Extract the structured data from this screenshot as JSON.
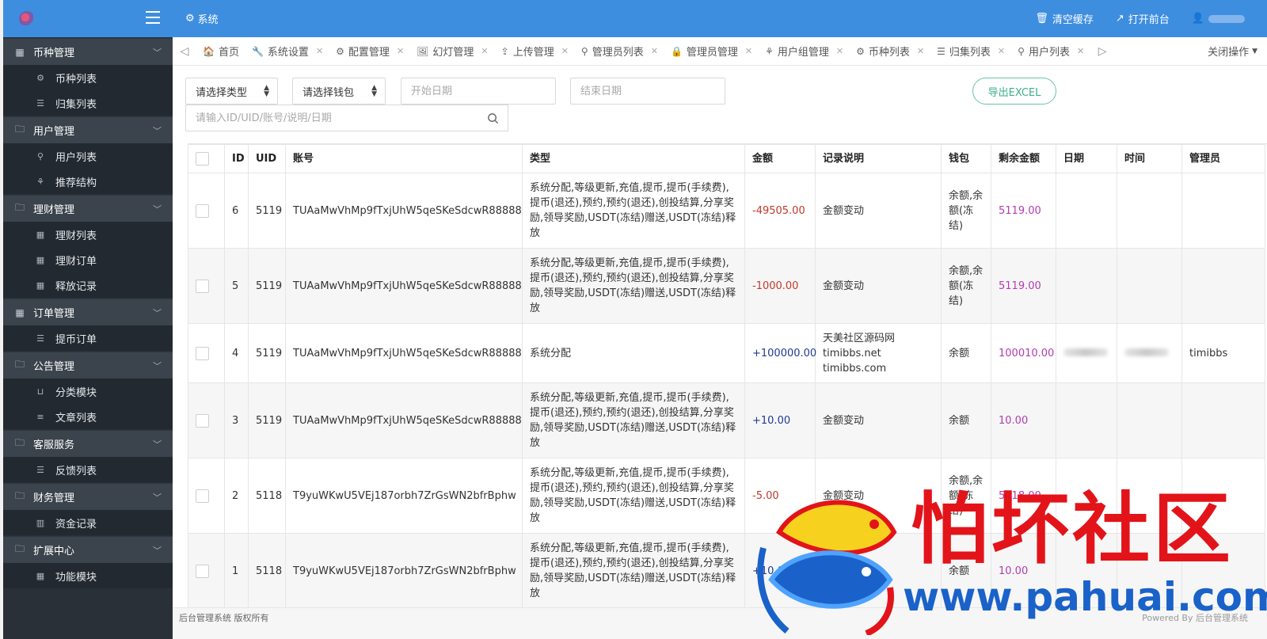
{
  "header": {
    "section": "系统",
    "clear_cache": "清空缓存",
    "open_frontend": "打开前台"
  },
  "sidebar": {
    "groups": [
      {
        "label": "币种管理",
        "items": [
          {
            "label": "币种列表",
            "icon": "cogs-icon"
          },
          {
            "label": "归集列表",
            "icon": "list-icon"
          }
        ]
      },
      {
        "label": "用户管理",
        "items": [
          {
            "label": "用户列表",
            "icon": "user-icon"
          },
          {
            "label": "推荐结构",
            "icon": "sitemap-icon"
          }
        ]
      },
      {
        "label": "理财管理",
        "items": [
          {
            "label": "理财列表",
            "icon": "grid-icon"
          },
          {
            "label": "理财订单",
            "icon": "grid-icon"
          },
          {
            "label": "释放记录",
            "icon": "grid-icon"
          }
        ]
      },
      {
        "label": "订单管理",
        "items": [
          {
            "label": "提币订单",
            "icon": "list-icon"
          }
        ]
      },
      {
        "label": "公告管理",
        "items": [
          {
            "label": "分类模块",
            "icon": "inbox-icon"
          },
          {
            "label": "文章列表",
            "icon": "align-icon"
          }
        ]
      },
      {
        "label": "客服服务",
        "items": [
          {
            "label": "反馈列表",
            "icon": "list-icon"
          }
        ]
      },
      {
        "label": "财务管理",
        "items": [
          {
            "label": "资金记录",
            "icon": "barcode-icon"
          }
        ]
      },
      {
        "label": "扩展中心",
        "items": [
          {
            "label": "功能模块",
            "icon": "grid-icon"
          }
        ]
      }
    ]
  },
  "tabs": {
    "items": [
      {
        "label": "首页",
        "closable": false
      },
      {
        "label": "系统设置",
        "closable": true
      },
      {
        "label": "配置管理",
        "closable": true
      },
      {
        "label": "幻灯管理",
        "closable": true
      },
      {
        "label": "上传管理",
        "closable": true
      },
      {
        "label": "管理员列表",
        "closable": true
      },
      {
        "label": "管理员管理",
        "closable": true
      },
      {
        "label": "用户组管理",
        "closable": true
      },
      {
        "label": "币种列表",
        "closable": true
      },
      {
        "label": "归集列表",
        "closable": true
      },
      {
        "label": "用户列表",
        "closable": true
      }
    ],
    "close_ops": "关闭操作"
  },
  "filters": {
    "type_select": "请选择类型",
    "wallet_select": "请选择钱包",
    "start_date_placeholder": "开始日期",
    "end_date_placeholder": "结束日期",
    "search_placeholder": "请输入ID/UID/账号/说明/日期",
    "export_label": "导出EXCEL"
  },
  "table": {
    "columns": [
      "ID",
      "UID",
      "账号",
      "类型",
      "金额",
      "记录说明",
      "钱包",
      "剩余金额",
      "日期",
      "时间",
      "管理员"
    ],
    "rows": [
      {
        "id": "6",
        "uid": "5119",
        "account": "TUAaMwVhMp9fTxjUhW5qeSKeSdcwR88888",
        "type": "系统分配,等级更新,充值,提币,提币(手续费),提币(退还),预约,预约(退还),创投结算,分享奖励,领导奖励,USDT(冻结)赠送,USDT(冻结)释放",
        "amount": "-49505.00",
        "sign": "neg",
        "note": "金额变动",
        "wallet": "余额,余额(冻结)",
        "remain": "5119.00",
        "admin": ""
      },
      {
        "id": "5",
        "uid": "5119",
        "account": "TUAaMwVhMp9fTxjUhW5qeSKeSdcwR88888",
        "type": "系统分配,等级更新,充值,提币,提币(手续费),提币(退还),预约,预约(退还),创投结算,分享奖励,领导奖励,USDT(冻结)赠送,USDT(冻结)释放",
        "amount": "-1000.00",
        "sign": "neg",
        "note": "金额变动",
        "wallet": "余额,余额(冻结)",
        "remain": "5119.00",
        "admin": ""
      },
      {
        "id": "4",
        "uid": "5119",
        "account": "TUAaMwVhMp9fTxjUhW5qeSKeSdcwR88888",
        "type": "系统分配",
        "amount": "+100000.00",
        "sign": "pos",
        "note": "天美社区源码网\ntimibbs.net\ntimibbs.com",
        "wallet": "余额",
        "remain": "100010.00",
        "admin": "timibbs"
      },
      {
        "id": "3",
        "uid": "5119",
        "account": "TUAaMwVhMp9fTxjUhW5qeSKeSdcwR88888",
        "type": "系统分配,等级更新,充值,提币,提币(手续费),提币(退还),预约,预约(退还),创投结算,分享奖励,领导奖励,USDT(冻结)赠送,USDT(冻结)释放",
        "amount": "+10.00",
        "sign": "pos",
        "note": "金额变动",
        "wallet": "余额",
        "remain": "10.00",
        "admin": ""
      },
      {
        "id": "2",
        "uid": "5118",
        "account": "T9yuWKwU5VEj187orbh7ZrGsWN2bfrBphw",
        "type": "系统分配,等级更新,充值,提币,提币(手续费),提币(退还),预约,预约(退还),创投结算,分享奖励,领导奖励,USDT(冻结)赠送,USDT(冻结)释放",
        "amount": "-5.00",
        "sign": "neg",
        "note": "金额变动",
        "wallet": "余额,余额(冻结)",
        "remain": "5118.00",
        "admin": ""
      },
      {
        "id": "1",
        "uid": "5118",
        "account": "T9yuWKwU5VEj187orbh7ZrGsWN2bfrBphw",
        "type": "系统分配,等级更新,充值,提币,提币(手续费),提币(退还),预约,预约(退还),创投结算,分享奖励,领导奖励,USDT(冻结)赠送,USDT(冻结)释放",
        "amount": "+10.00",
        "sign": "pos",
        "note": "金额变动",
        "wallet": "余额",
        "remain": "10.00",
        "admin": ""
      }
    ]
  },
  "footer": {
    "left": "后台管理系统 版权所有",
    "right": "Powered By 后台管理系统"
  },
  "watermark": {
    "cn": "怕坏社区",
    "url": "www.pahuai.com"
  },
  "colors": {
    "accent": "#3e8ee0",
    "sidebar_bg": "#293038",
    "negative": "#c0392b",
    "positive": "#1f3a93",
    "remain": "#b23cb0",
    "export": "#3fae87"
  }
}
